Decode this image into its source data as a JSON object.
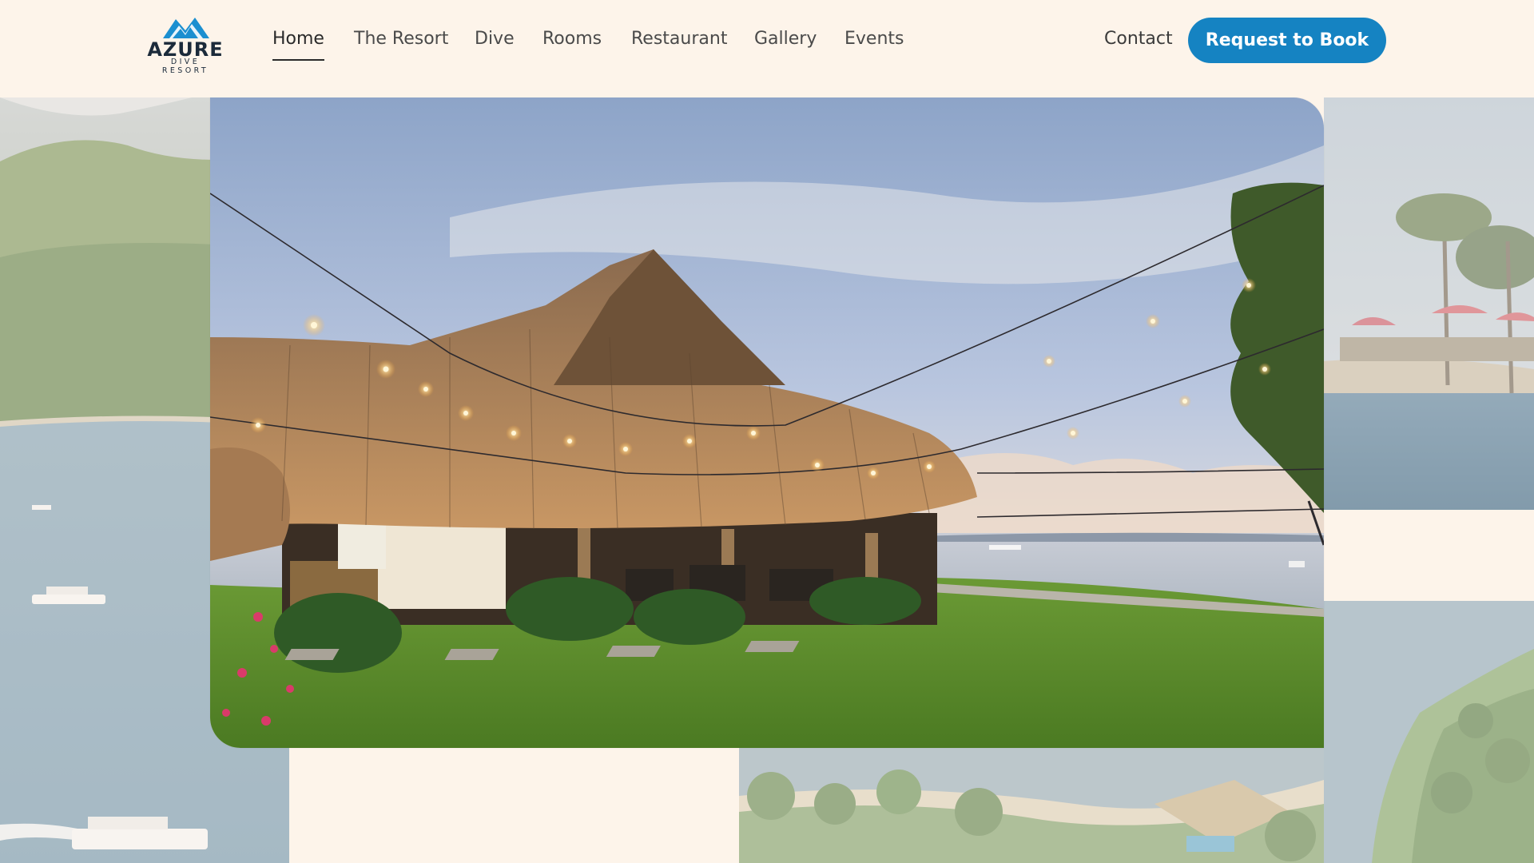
{
  "brand": {
    "name": "AZURE",
    "tagline": "DIVE RESORT",
    "colors": {
      "accent": "#1583c2",
      "background": "#fdf4ea",
      "logo_blue": "#1b8fd0"
    }
  },
  "nav": {
    "items": [
      {
        "label": "Home",
        "active": true
      },
      {
        "label": "The Resort",
        "active": false
      },
      {
        "label": "Dive",
        "active": false
      },
      {
        "label": "Rooms",
        "active": false
      },
      {
        "label": "Restaurant",
        "active": false
      },
      {
        "label": "Gallery",
        "active": false
      },
      {
        "label": "Events",
        "active": false
      }
    ],
    "contact_label": "Contact",
    "book_label": "Request to Book"
  },
  "images": {
    "hero": "restaurant-thatched-pavilion-with-string-lights",
    "left": "aerial-coastline-with-boats",
    "right_top": "pool-with-umbrellas-and-palms",
    "right_bottom": "aerial-coast-with-palms",
    "bottom": "aerial-resort-grounds"
  }
}
